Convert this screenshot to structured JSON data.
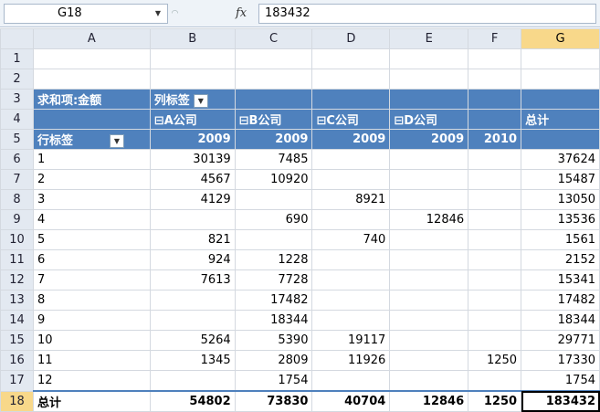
{
  "formula_bar": {
    "name_box": "G18",
    "fx_symbol": "fx",
    "value": "183432"
  },
  "columns": [
    "A",
    "B",
    "C",
    "D",
    "E",
    "F",
    "G"
  ],
  "row_numbers": [
    "1",
    "2",
    "3",
    "4",
    "5",
    "6",
    "7",
    "8",
    "9",
    "10",
    "11",
    "12",
    "13",
    "14",
    "15",
    "16",
    "17",
    "18"
  ],
  "pivot": {
    "sum_label": "求和项:金额",
    "col_label": "列标签",
    "row_label": "行标签",
    "companies": [
      "⊟A公司",
      "⊟B公司",
      "⊟C公司",
      "⊟D公司"
    ],
    "total_label": "总计",
    "years": [
      "2009",
      "2009",
      "2009",
      "2009",
      "2010"
    ],
    "rows": [
      {
        "k": "1",
        "b": "30139",
        "c": "7485",
        "d": "",
        "e": "",
        "f": "",
        "g": "37624"
      },
      {
        "k": "2",
        "b": "4567",
        "c": "10920",
        "d": "",
        "e": "",
        "f": "",
        "g": "15487"
      },
      {
        "k": "3",
        "b": "4129",
        "c": "",
        "d": "8921",
        "e": "",
        "f": "",
        "g": "13050"
      },
      {
        "k": "4",
        "b": "",
        "c": "690",
        "d": "",
        "e": "12846",
        "f": "",
        "g": "13536"
      },
      {
        "k": "5",
        "b": "821",
        "c": "",
        "d": "740",
        "e": "",
        "f": "",
        "g": "1561"
      },
      {
        "k": "6",
        "b": "924",
        "c": "1228",
        "d": "",
        "e": "",
        "f": "",
        "g": "2152"
      },
      {
        "k": "7",
        "b": "7613",
        "c": "7728",
        "d": "",
        "e": "",
        "f": "",
        "g": "15341"
      },
      {
        "k": "8",
        "b": "",
        "c": "17482",
        "d": "",
        "e": "",
        "f": "",
        "g": "17482"
      },
      {
        "k": "9",
        "b": "",
        "c": "18344",
        "d": "",
        "e": "",
        "f": "",
        "g": "18344"
      },
      {
        "k": "10",
        "b": "5264",
        "c": "5390",
        "d": "19117",
        "e": "",
        "f": "",
        "g": "29771"
      },
      {
        "k": "11",
        "b": "1345",
        "c": "2809",
        "d": "11926",
        "e": "",
        "f": "1250",
        "g": "17330"
      },
      {
        "k": "12",
        "b": "",
        "c": "1754",
        "d": "",
        "e": "",
        "f": "",
        "g": "1754"
      }
    ],
    "grand_total": {
      "k": "总计",
      "b": "54802",
      "c": "73830",
      "d": "40704",
      "e": "12846",
      "f": "1250",
      "g": "183432"
    }
  },
  "colors": {
    "pivot_header": "#4f81bd",
    "selection": "#f8d88a"
  }
}
